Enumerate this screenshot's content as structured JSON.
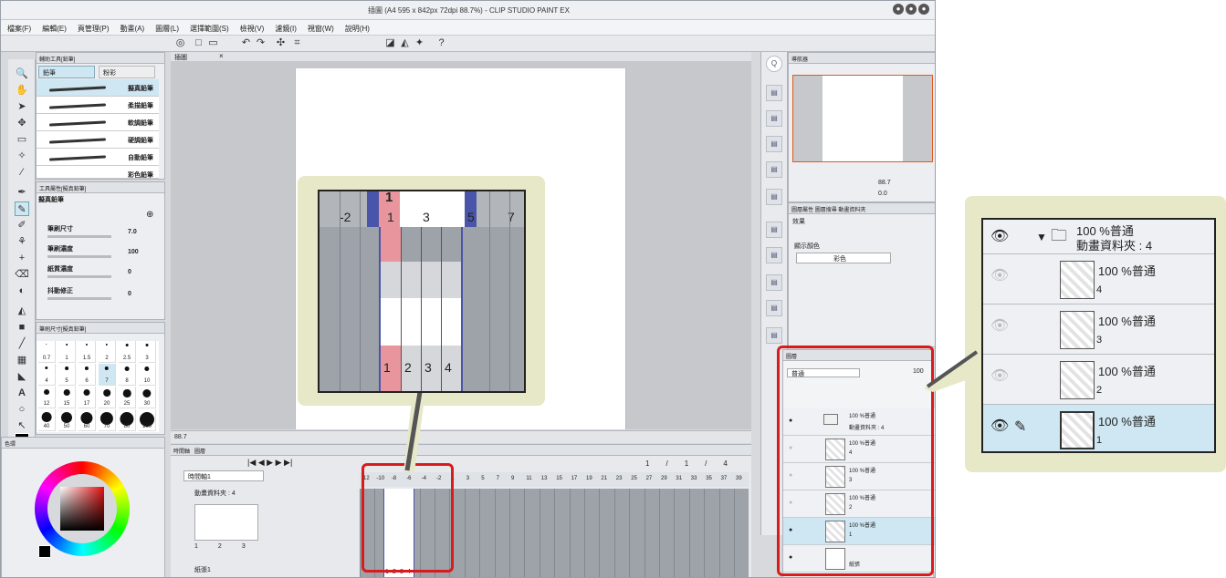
{
  "window": {
    "title": "插圖 (A4 595 x 842px 72dpi 88.7%) - CLIP STUDIO PAINT EX",
    "controls": [
      "●",
      "●",
      "●"
    ]
  },
  "menu": [
    "檔案(F)",
    "編輯(E)",
    "頁管理(P)",
    "動畫(A)",
    "圖層(L)",
    "選擇範圍(S)",
    "檢視(V)",
    "濾鏡(I)",
    "視窗(W)",
    "說明(H)"
  ],
  "canvas_tab": "插圖",
  "subtool_panel": {
    "header": "輔助工具[鉛筆]",
    "tabs": [
      "鉛筆",
      "粉彩"
    ],
    "brushes": [
      "擬真鉛筆",
      "柔描鉛筆",
      "軟調鉛筆",
      "硬調鉛筆",
      "自動鉛筆",
      "彩色鉛筆"
    ]
  },
  "tool_property": {
    "header": "工具屬性[擬真鉛筆]",
    "brush_name": "擬真鉛筆",
    "rows": [
      {
        "label": "筆刷尺寸",
        "value": "7.0"
      },
      {
        "label": "筆刷濃度",
        "value": "100"
      },
      {
        "label": "紙質濃度",
        "value": "0"
      },
      {
        "label": "抖動修正",
        "value": "0"
      }
    ]
  },
  "brush_size": {
    "header": "筆刷尺寸[擬真鉛筆]",
    "sizes": [
      "0.7",
      "1",
      "1.5",
      "2",
      "2.5",
      "3",
      "4",
      "5",
      "6",
      "7",
      "8",
      "10",
      "12",
      "15",
      "17",
      "20",
      "25",
      "30",
      "40",
      "50",
      "60",
      "70",
      "80",
      "100"
    ]
  },
  "color_panel": {
    "header": "色環"
  },
  "timeline": {
    "tabs": [
      "時間軸",
      "圖層"
    ],
    "timeline_name": "時間軸1",
    "track_label": "動畫資料夾 : 4",
    "paper_label": "紙張1",
    "frame_counter": [
      "1",
      "/",
      "1",
      "/",
      "4"
    ],
    "ruler_numbers": [
      "-12",
      "-10",
      "-8",
      "-6",
      "-4",
      "-2",
      "1",
      "3",
      "5",
      "7",
      "9",
      "11",
      "13",
      "15",
      "17",
      "19",
      "21",
      "23",
      "25",
      "27",
      "29",
      "31",
      "33",
      "35",
      "37",
      "39"
    ],
    "cels": [
      "1",
      "2",
      "3",
      "4"
    ],
    "thumb_frames": [
      "1",
      "2",
      "3"
    ],
    "zoom_value": "88.7"
  },
  "navigator": {
    "header": "導航器",
    "zoom": "88.7",
    "rotation": "0.0"
  },
  "layer_property": {
    "tabs": [
      "圖層屬性",
      "圖層搜尋",
      "動畫資料夾"
    ],
    "effect_label": "效果",
    "display_color_label": "顯示顏色",
    "display_color_value": "彩色"
  },
  "layer_panel": {
    "header": "圖層",
    "blend_mode": "普通",
    "opacity": "100",
    "layers": [
      {
        "opacity_mode": "100 %普通",
        "name": "動畫資料夾 : 4",
        "type": "folder"
      },
      {
        "opacity_mode": "100 %普通",
        "name": "4"
      },
      {
        "opacity_mode": "100 %普通",
        "name": "3"
      },
      {
        "opacity_mode": "100 %普通",
        "name": "2"
      },
      {
        "opacity_mode": "100 %普通",
        "name": "1",
        "selected": true
      },
      {
        "opacity_mode": "",
        "name": "紙張",
        "type": "paper"
      }
    ]
  },
  "zoom_callout": {
    "marker": "1",
    "ruler_numbers": [
      "-2",
      "1",
      "3",
      "5",
      "7"
    ],
    "cels": [
      "1",
      "2",
      "3",
      "4"
    ]
  },
  "layer_callout": {
    "folder_line1": "100 %普通",
    "folder_line2": "動畫資料夾 : 4",
    "layers": [
      {
        "opacity_mode": "100 %普通",
        "name": "4"
      },
      {
        "opacity_mode": "100 %普通",
        "name": "3"
      },
      {
        "opacity_mode": "100 %普通",
        "name": "2"
      },
      {
        "opacity_mode": "100 %普通",
        "name": "1"
      }
    ]
  },
  "colors": {
    "accent_red": "#d81c1c",
    "callout_bg": "#e6e8c7",
    "selection_blue": "#cfe6f3",
    "cel_pink": "#e8959d",
    "marker_blue": "#4955a8"
  }
}
